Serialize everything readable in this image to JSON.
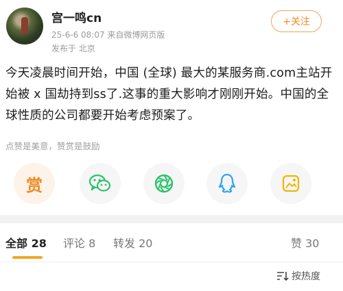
{
  "header": {
    "username": "宫一鸣cn",
    "time_source": "25-6-6 08:07  来自微博网页版",
    "location": "发布于 北京",
    "follow_label": "+关注"
  },
  "post": {
    "text": "今天凌晨时间开始，中国 (全球) 最大的某服务商.com主站开始被 x 国劫持到ss了.这事的重大影响才刚刚开始。中国的全球性质的公司都要开始考虑预案了。"
  },
  "reward_tip": "点赞是美意，赞赏是鼓励",
  "share": {
    "reward_char": "赏",
    "icons": [
      "reward-icon",
      "wechat-icon",
      "moments-icon",
      "qq-icon",
      "qzone-icon"
    ]
  },
  "tabs": [
    {
      "label": "全部",
      "count": "28"
    },
    {
      "label": "评论",
      "count": "8"
    },
    {
      "label": "转发",
      "count": "20"
    },
    {
      "label": "赞",
      "count": "30"
    }
  ],
  "sort_label": "按热度",
  "colors": {
    "accent_orange": "#f5a623",
    "follow_orange": "#f08a24",
    "wechat_green": "#2dc26c",
    "qq_blue": "#2aa4f4",
    "qzone_yellow": "#f4b400"
  }
}
